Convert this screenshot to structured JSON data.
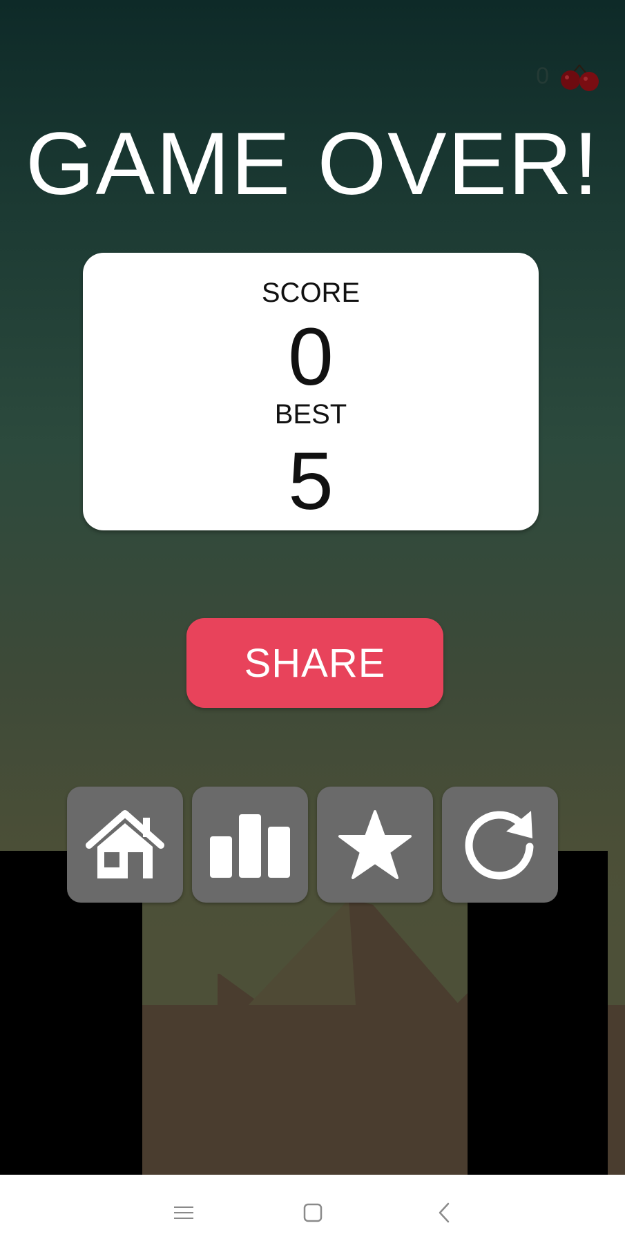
{
  "hud": {
    "cherry_count": "0",
    "cherry_icon": "cherry-icon"
  },
  "title": "GAME OVER!",
  "score_card": {
    "score_label": "SCORE",
    "score_value": "0",
    "best_label": "BEST",
    "best_value": "5"
  },
  "share_label": "SHARE",
  "actions": [
    "home-icon",
    "leaderboard-icon",
    "star-icon",
    "restart-icon"
  ],
  "navbar": [
    "menu-icon",
    "home-square-icon",
    "back-icon"
  ],
  "colors": {
    "share": "#e8435b",
    "action_button": "#6a6a6a",
    "card": "#ffffff",
    "cherry": "#7a0d12"
  }
}
